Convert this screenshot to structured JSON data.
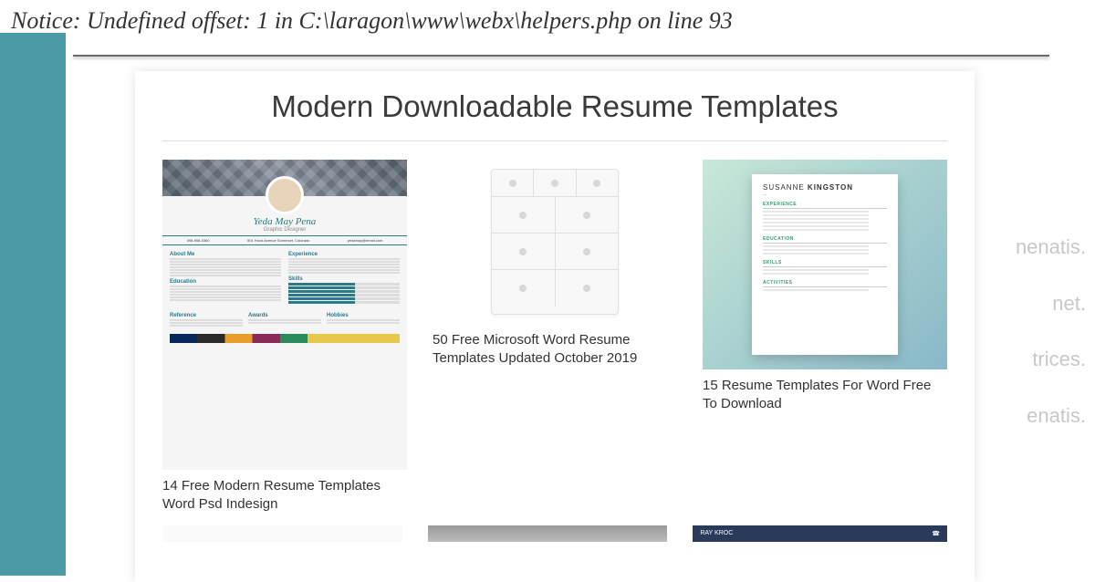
{
  "error_notice": "Notice: Undefined offset: 1 in C:\\laragon\\www\\webx\\helpers.php on line 93",
  "bg_words": [
    "nenatis.",
    "net.",
    "trices.",
    "enatis."
  ],
  "page_title": "Modern Downloadable Resume Templates",
  "items": [
    {
      "caption": "14 Free Modern Resume Templates Word Psd Indesign",
      "resume_name": "Yeda May Pena",
      "resume_role": "Graphic Designer",
      "contact": [
        "098-958-0360",
        "501 Hood Avenue Somerset, Colorado",
        "yedamay@email.com"
      ],
      "sections_left": [
        "About Me",
        "Education",
        "Reference"
      ],
      "sections_right": [
        "Experience",
        "Skills",
        "Awards",
        "Hobbies"
      ]
    },
    {
      "caption": "50 Free Microsoft Word Resume Templates Updated October 2019"
    },
    {
      "caption": "15 Resume Templates For Word Free To Download",
      "resume_name_first": "SUSANNE",
      "resume_name_last": "KINGSTON",
      "sections": [
        "EXPERIENCE",
        "EDUCATION",
        "SKILLS",
        "ACTIVITIES"
      ]
    }
  ],
  "row2_name": "RAY KROC"
}
